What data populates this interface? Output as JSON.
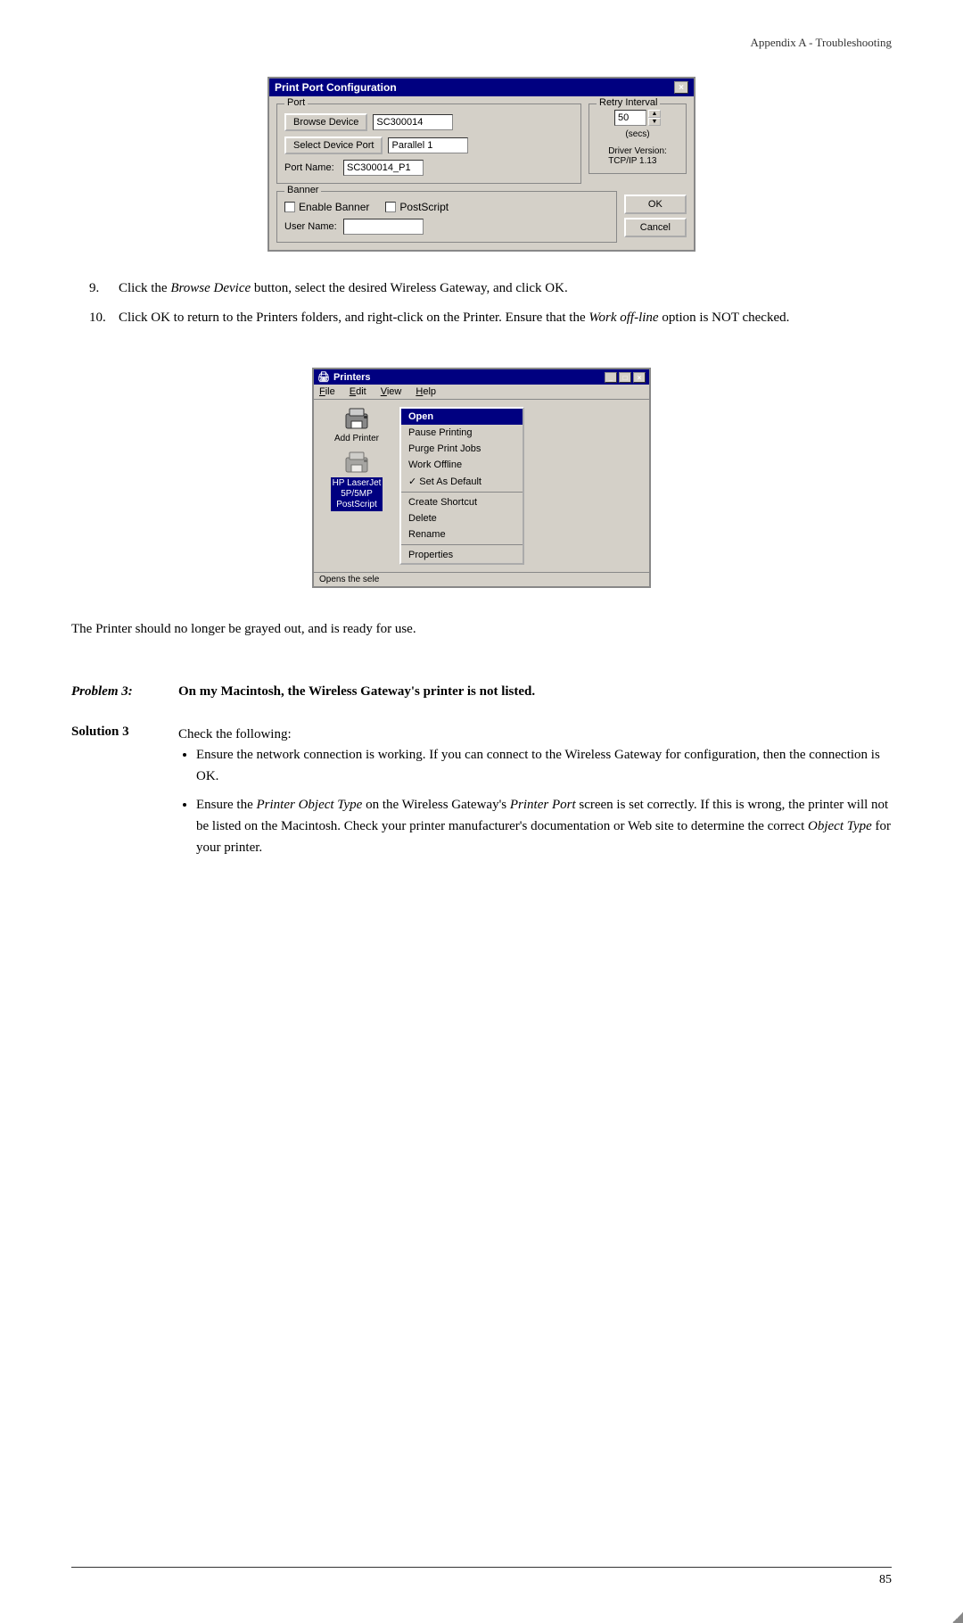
{
  "header": {
    "title": "Appendix A - Troubleshooting"
  },
  "dialog1": {
    "title": "Print Port Configuration",
    "close_btn": "×",
    "port_group_label": "Port",
    "browse_device_btn": "Browse Device",
    "device_value": "SC300014",
    "select_device_btn": "Select Device Port",
    "parallel_value": "Parallel 1",
    "port_name_label": "Port Name:",
    "port_name_value": "SC300014_P1",
    "retry_group_label": "Retry Interval",
    "retry_value": "50",
    "retry_unit": "(secs)",
    "driver_label": "Driver Version:",
    "driver_value": "TCP/IP  1.13",
    "banner_group_label": "Banner",
    "enable_banner_label": "Enable Banner",
    "postscript_label": "PostScript",
    "username_label": "User Name:",
    "ok_btn": "OK",
    "cancel_btn": "Cancel"
  },
  "instructions": [
    {
      "num": "9.",
      "text_before": "Click the ",
      "italic": "Browse Device",
      "text_after": " button, select the desired Wireless Gateway, and click OK."
    },
    {
      "num": "10.",
      "text_before": "Click OK to return to the Printers folders, and right-click on the Printer. Ensure that the ",
      "italic": "Work off-line",
      "text_after": " option is NOT checked."
    }
  ],
  "printers_win": {
    "title": "Printers",
    "title_icon": "🖨",
    "menubar": [
      "File",
      "Edit",
      "View",
      "Help"
    ],
    "underlines": [
      "F",
      "E",
      "V",
      "H"
    ],
    "add_printer_label": "Add Printer",
    "printer_label": "HP LaserJet\n5P/5MP\nPostScript",
    "context_menu": {
      "open": "Open",
      "items": [
        "Pause Printing",
        "Purge Print Jobs",
        "Work Offline",
        "✓ Set As Default",
        "",
        "Create Shortcut",
        "Delete",
        "Rename",
        "",
        "Properties"
      ]
    },
    "status_bar": "Opens the sele"
  },
  "body_text": "The Printer should no longer be grayed out, and is ready for use.",
  "problem": {
    "label": "Problem 3:",
    "text": "On my Macintosh, the Wireless Gateway's printer is not listed."
  },
  "solution": {
    "label": "Solution 3",
    "intro": "Check the following:",
    "bullets": [
      {
        "text_before": "Ensure the network connection is working. If you can connect to the Wireless Gateway for configuration, then the connection is OK."
      },
      {
        "text_before": "Ensure the ",
        "italic1": "Printer Object Type",
        "text_mid1": " on the Wireless Gateway's ",
        "italic2": "Printer Port",
        "text_mid2": " screen is set correctly. If this is wrong, the printer will not be listed on the Macintosh. Check your printer manufacturer's documentation or Web site to determine the correct ",
        "italic3": "Object Type",
        "text_end": " for your printer."
      }
    ]
  },
  "footer": {
    "page_num": "85"
  }
}
